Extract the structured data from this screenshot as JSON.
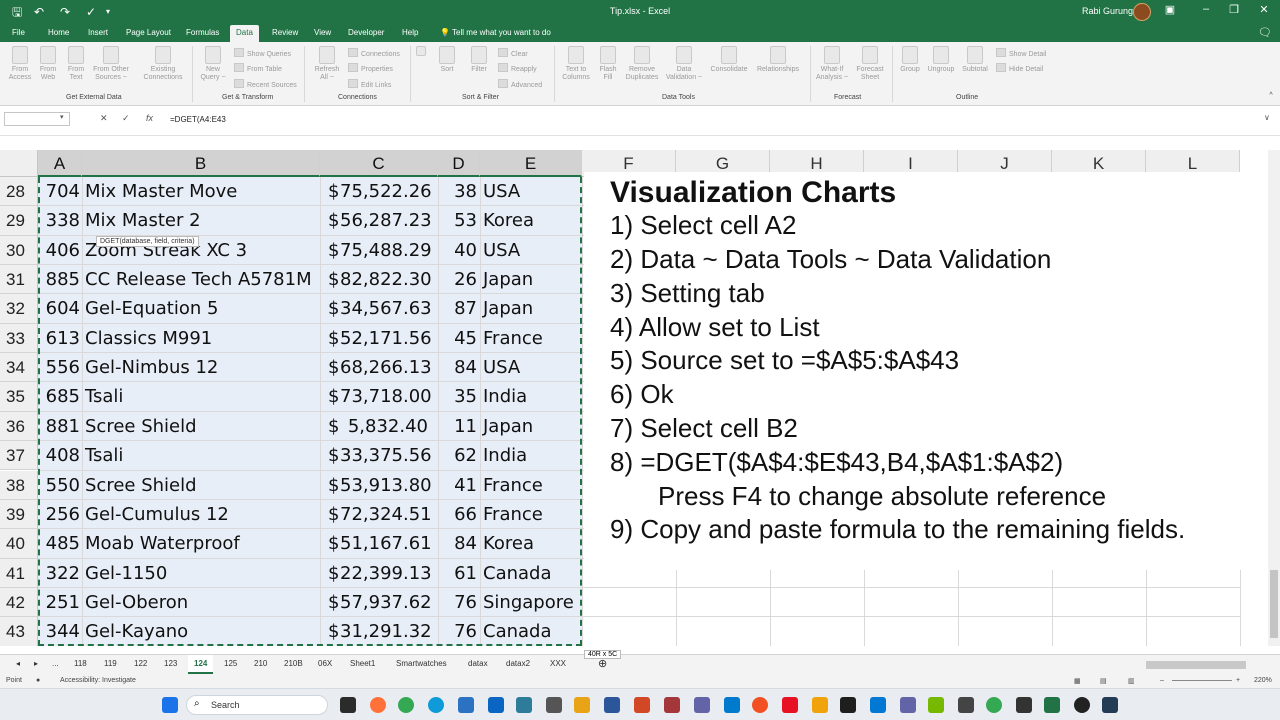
{
  "window": {
    "title": "Tip.xlsx  -  Excel",
    "user": "Rabi Gurung"
  },
  "ribbon_tabs": [
    "File",
    "Home",
    "Insert",
    "Page Layout",
    "Formulas",
    "Data",
    "Review",
    "Developer",
    "Help"
  ],
  "active_tab": "Data",
  "tell_me": "Tell me what you want to do",
  "ribbon": {
    "get_external": {
      "buttons": [
        "From\nAccess",
        "From\nWeb",
        "From\nText",
        "From Other\nSources ~",
        "Existing\nConnections"
      ],
      "label": "Get External Data"
    },
    "get_transform": {
      "new_query": "New\nQuery ~",
      "small": [
        "Show Queries",
        "From Table",
        "Recent Sources"
      ],
      "label": "Get & Transform"
    },
    "connections": {
      "refresh": "Refresh\nAll ~",
      "small": [
        "Connections",
        "Properties",
        "Edit Links"
      ],
      "label": "Connections"
    },
    "sort_filter": {
      "sort": "Sort",
      "filter": "Filter",
      "small": [
        "Clear",
        "Reapply",
        "Advanced"
      ],
      "label": "Sort & Filter"
    },
    "data_tools": {
      "buttons": [
        "Text to\nColumns",
        "Flash\nFill",
        "Remove\nDuplicates",
        "Data\nValidation ~",
        "Consolidate",
        "Relationships"
      ],
      "label": "Data Tools"
    },
    "forecast": {
      "buttons": [
        "What-If\nAnalysis ~",
        "Forecast\nSheet"
      ],
      "label": "Forecast"
    },
    "outline": {
      "buttons": [
        "Group",
        "Ungroup",
        "Subtotal"
      ],
      "small": [
        "Show Detail",
        "Hide Detail"
      ],
      "label": "Outline"
    }
  },
  "formula_bar": {
    "name_box": "",
    "cancel": "✕",
    "enter": "✓",
    "fx": "fx",
    "formula": "=DGET(A4:E43"
  },
  "columns": [
    "A",
    "B",
    "C",
    "D",
    "E",
    "F",
    "G",
    "H",
    "I",
    "J",
    "K",
    "L"
  ],
  "rows": [
    {
      "num": "28",
      "a": "704",
      "b": "Mix Master Move",
      "c_sym": "$",
      "c": "75,522.26",
      "d": "38",
      "e": "USA"
    },
    {
      "num": "29",
      "a": "338",
      "b": "Mix Master 2",
      "c_sym": "$",
      "c": "56,287.23",
      "d": "53",
      "e": "Korea"
    },
    {
      "num": "30",
      "a": "406",
      "b": "Zoom Streak XC 3",
      "c_sym": "$",
      "c": "75,488.29",
      "d": "40",
      "e": "USA"
    },
    {
      "num": "31",
      "a": "885",
      "b": "CC Release Tech A5781M",
      "c_sym": "$",
      "c": "82,822.30",
      "d": "26",
      "e": "Japan"
    },
    {
      "num": "32",
      "a": "604",
      "b": "Gel-Equation 5",
      "c_sym": "$",
      "c": "34,567.63",
      "d": "87",
      "e": "Japan"
    },
    {
      "num": "33",
      "a": "613",
      "b": "Classics M991",
      "c_sym": "$",
      "c": "52,171.56",
      "d": "45",
      "e": "France"
    },
    {
      "num": "34",
      "a": "556",
      "b": "Gel-Nimbus 12",
      "c_sym": "$",
      "c": "68,266.13",
      "d": "84",
      "e": "USA"
    },
    {
      "num": "35",
      "a": "685",
      "b": "Tsali",
      "c_sym": "$",
      "c": "73,718.00",
      "d": "35",
      "e": "India"
    },
    {
      "num": "36",
      "a": "881",
      "b": "Scree Shield",
      "c_sym": "$",
      "c": "5,832.40",
      "d": "11",
      "e": "Japan"
    },
    {
      "num": "37",
      "a": "408",
      "b": "Tsali",
      "c_sym": "$",
      "c": "33,375.56",
      "d": "62",
      "e": "India"
    },
    {
      "num": "38",
      "a": "550",
      "b": "Scree Shield",
      "c_sym": "$",
      "c": "53,913.80",
      "d": "41",
      "e": "France"
    },
    {
      "num": "39",
      "a": "256",
      "b": "Gel-Cumulus 12",
      "c_sym": "$",
      "c": "72,324.51",
      "d": "66",
      "e": "France"
    },
    {
      "num": "40",
      "a": "485",
      "b": "Moab Waterproof",
      "c_sym": "$",
      "c": "51,167.61",
      "d": "84",
      "e": "Korea"
    },
    {
      "num": "41",
      "a": "322",
      "b": "Gel-1150",
      "c_sym": "$",
      "c": "22,399.13",
      "d": "61",
      "e": "Canada"
    },
    {
      "num": "42",
      "a": "251",
      "b": "Gel-Oberon",
      "c_sym": "$",
      "c": "57,937.62",
      "d": "76",
      "e": "Singapore"
    },
    {
      "num": "43",
      "a": "344",
      "b": "Gel-Kayano",
      "c_sym": "$",
      "c": "31,291.32",
      "d": "76",
      "e": "Canada"
    }
  ],
  "tooltip": "DGET(database, field, criteria)",
  "textbox": {
    "title": "Visualization Charts",
    "lines": [
      "1) Select cell A2",
      "2) Data ~ Data Tools ~ Data Validation",
      "3) Setting tab",
      "4) Allow set to List",
      "5) Source set to =$A$5:$A$43",
      "6) Ok",
      "7) Select cell B2",
      "8) =DGET($A$4:$E$43,B4,$A$1:$A$2)",
      "     Press F4 to change absolute reference",
      "9) Copy and paste formula to the remaining fields."
    ]
  },
  "sheet_tabs": [
    "...",
    "118",
    "119",
    "122",
    "123",
    "124",
    "125",
    "210",
    "210B",
    "06X",
    "Sheet1",
    "Smartwatches",
    "datax",
    "datax2",
    "XXX"
  ],
  "active_sheet": "124",
  "size_tip": "40R x 5C",
  "status": {
    "mode": "Point",
    "accessibility": "Accessibility: Investigate",
    "zoom": "220%"
  },
  "taskbar": {
    "search": "Search"
  },
  "colors": {
    "excel_green": "#217346",
    "selection": "#e8eef8"
  }
}
